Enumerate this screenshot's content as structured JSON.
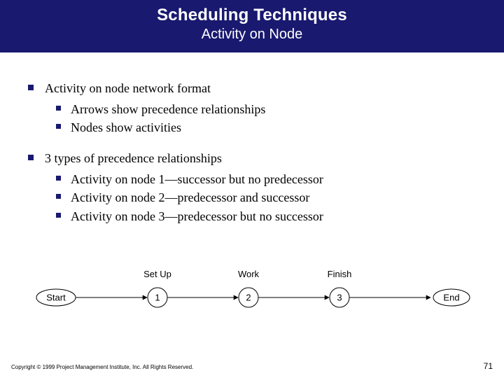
{
  "header": {
    "title": "Scheduling Techniques",
    "subtitle": "Activity on Node"
  },
  "bullets": [
    {
      "text": "Activity on node network format",
      "children": [
        {
          "text": "Arrows show precedence relationships"
        },
        {
          "text": "Nodes show activities"
        }
      ]
    },
    {
      "text": "3 types of precedence relationships",
      "children": [
        {
          "text": "Activity on node 1—successor but no predecessor"
        },
        {
          "text": "Activity on node 2—predecessor and successor"
        },
        {
          "text": "Activity on node 3—predecessor but no successor"
        }
      ]
    }
  ],
  "diagram": {
    "start": "Start",
    "end": "End",
    "nodes": [
      {
        "id": "1",
        "label": "Set Up"
      },
      {
        "id": "2",
        "label": "Work"
      },
      {
        "id": "3",
        "label": "Finish"
      }
    ]
  },
  "footer": {
    "copyright": "Copyright © 1999 Project Management Institute, Inc. All Rights Reserved.",
    "page": "71"
  }
}
